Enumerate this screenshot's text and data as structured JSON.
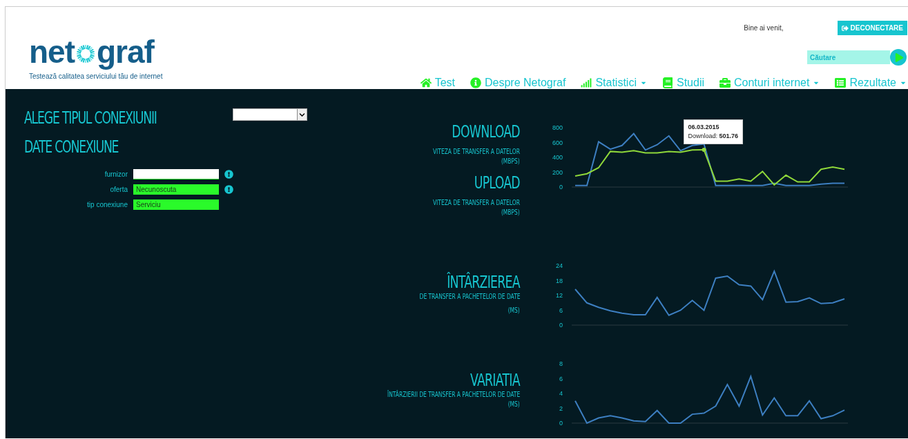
{
  "header": {
    "logo": {
      "left": "net",
      "right": "graf",
      "tagline": "Testează calitatea serviciului tău de internet"
    },
    "welcome": "Bine ai venit,",
    "logout_button": "DECONECTARE",
    "search": {
      "placeholder": "Căutare"
    },
    "nav": [
      {
        "label": "Test",
        "has_menu": false
      },
      {
        "label": "Despre Netograf",
        "has_menu": false
      },
      {
        "label": "Statistici",
        "has_menu": true
      },
      {
        "label": "Studii",
        "has_menu": false
      },
      {
        "label": "Conturi internet",
        "has_menu": true
      },
      {
        "label": "Rezultate",
        "has_menu": true
      }
    ]
  },
  "connection": {
    "type_title": "ALEGE TIPUL CONEXIUNII",
    "data_title": "DATE CONEXIUNE",
    "fields": [
      {
        "label": "furnizor",
        "valid": false,
        "warning": true
      },
      {
        "label": "oferta",
        "value": "Necunoscuta",
        "valid": true,
        "warning": true
      },
      {
        "label": "tip conexiune",
        "value": "Serviciu",
        "valid": true,
        "warning": false
      }
    ]
  },
  "sections": [
    {
      "titles": [
        {
          "title": "DOWNLOAD",
          "subtitle": "VITEZA DE TRANSFER A DATELOR",
          "unit": "(MBPS)"
        },
        {
          "title": "UPLOAD",
          "subtitle": "VITEZA DE TRANSFER A DATELOR",
          "unit": "(MBPS)"
        }
      ],
      "chart_data": {
        "type": "line",
        "ylim": [
          0,
          800
        ],
        "yticks": [
          0,
          200,
          400,
          600,
          800
        ],
        "series": [
          {
            "color": "#3d7fc1",
            "values": [
              20,
              20,
              610,
              510,
              560,
              720,
              500,
              570,
              690,
              490,
              560,
              580,
              20,
              20,
              20,
              20,
              20,
              50,
              20,
              20,
              20,
              40,
              50,
              50
            ]
          },
          {
            "color": "#8fd83a",
            "values": [
              150,
              180,
              260,
              480,
              470,
              490,
              460,
              460,
              480,
              470,
              500,
              501.76,
              80,
              80,
              110,
              80,
              210,
              30,
              160,
              70,
              70,
              240,
              270,
              240
            ]
          }
        ],
        "annotations": [
          "06.03.2015",
          "Download: **501.76**"
        ]
      }
    },
    {
      "titles": [
        {
          "title": "ÎNTÂRZIEREA",
          "subtitle": "DE TRANSFER A PACHETELOR DE DATE",
          "unit": "(MS)"
        }
      ],
      "chart_data": {
        "type": "line",
        "ylim": [
          0,
          24
        ],
        "yticks": [
          0,
          6,
          12,
          18,
          24
        ],
        "series": [
          {
            "color": "#3d7fc1",
            "values": [
              14.5,
              9,
              7.2,
              5.8,
              4.8,
              4.2,
              4.2,
              11.2,
              4,
              6,
              10,
              6,
              19,
              19.8,
              16.3,
              15.8,
              10.3,
              21.8,
              9.3,
              9.5,
              11,
              8.7,
              9,
              10.6
            ]
          }
        ]
      }
    },
    {
      "titles": [
        {
          "title": "VARIATIA",
          "subtitle": "ÎNTÂRZIERII DE TRANSFER A PACHETELOR DE DATE",
          "unit": "(MS)"
        }
      ],
      "chart_data": {
        "type": "line",
        "ylim": [
          0,
          8
        ],
        "yticks": [
          0,
          2,
          4,
          6,
          8
        ],
        "series": [
          {
            "color": "#3d7fc1",
            "values": [
              3,
              0,
              0.7,
              1,
              0.7,
              0.3,
              0.2,
              1.7,
              0,
              0,
              1.2,
              1.35,
              2.3,
              5.2,
              2.3,
              6.3,
              1.1,
              3.4,
              1,
              1,
              3,
              0.6,
              1,
              1.75
            ]
          }
        ]
      }
    }
  ]
}
